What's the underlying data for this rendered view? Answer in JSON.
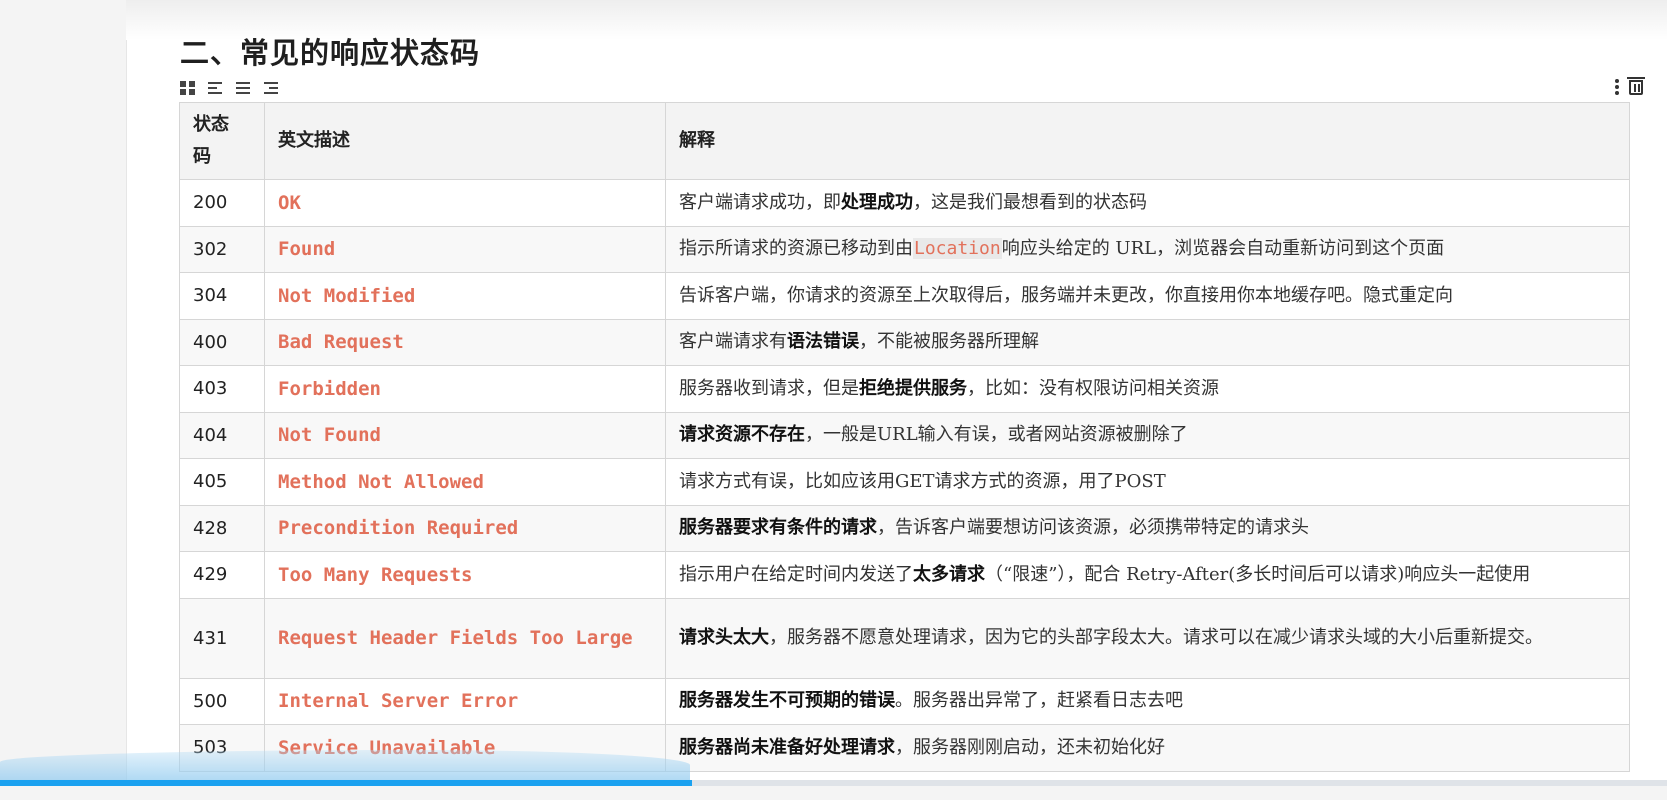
{
  "heading": "二、常见的响应状态码",
  "table": {
    "headers": [
      "状态\n码",
      "英文描述",
      "解释"
    ],
    "rows": [
      {
        "code": "200",
        "desc": "OK",
        "expl": [
          {
            "t": "客户端请求成功，即"
          },
          {
            "t": "处理成功",
            "b": true
          },
          {
            "t": "，这是我们最想看到的状态码"
          }
        ]
      },
      {
        "code": "302",
        "desc": "Found",
        "expl": [
          {
            "t": "指示所请求的资源已移动到由"
          },
          {
            "t": "Location",
            "c": true
          },
          {
            "t": "响应头给定的 URL，浏览器会自动重新访问到这个页面"
          }
        ]
      },
      {
        "code": "304",
        "desc": "Not Modified",
        "expl": [
          {
            "t": "告诉客户端，你请求的资源至上次取得后，服务端并未更改，你直接用你本地缓存吧。隐式重定向"
          }
        ]
      },
      {
        "code": "400",
        "desc": "Bad Request",
        "expl": [
          {
            "t": "客户端请求有"
          },
          {
            "t": "语法错误",
            "b": true
          },
          {
            "t": "，不能被服务器所理解"
          }
        ]
      },
      {
        "code": "403",
        "desc": "Forbidden",
        "expl": [
          {
            "t": "服务器收到请求，但是"
          },
          {
            "t": "拒绝提供服务",
            "b": true
          },
          {
            "t": "，比如：没有权限访问相关资源"
          }
        ]
      },
      {
        "code": "404",
        "desc": "Not Found",
        "expl": [
          {
            "t": "请求资源不存在",
            "b": true
          },
          {
            "t": "，一般是URL输入有误，或者网站资源被删除了"
          }
        ]
      },
      {
        "code": "405",
        "desc": "Method Not Allowed",
        "expl": [
          {
            "t": "请求方式有误，比如应该用GET请求方式的资源，用了POST"
          }
        ]
      },
      {
        "code": "428",
        "desc": "Precondition Required",
        "expl": [
          {
            "t": "服务器要求有条件的请求",
            "b": true
          },
          {
            "t": "，告诉客户端要想访问该资源，必须携带特定的请求头"
          }
        ]
      },
      {
        "code": "429",
        "desc": "Too Many Requests",
        "expl": [
          {
            "t": "指示用户在给定时间内发送了"
          },
          {
            "t": "太多请求",
            "b": true
          },
          {
            "t": "（“限速”），配合 Retry-After(多长时间后可以请求)响应头一起使用"
          }
        ]
      },
      {
        "code": "431",
        "desc": "Request Header Fields Too Large",
        "tall": true,
        "expl": [
          {
            "t": "请求头太大",
            "b": true
          },
          {
            "t": "，服务器不愿意处理请求，因为它的头部字段太大。请求可以在减少请求头域的大小后重新提交。"
          }
        ]
      },
      {
        "code": "500",
        "desc": "Internal Server Error",
        "expl": [
          {
            "t": "服务器发生不可预期的错误",
            "b": true
          },
          {
            "t": "。服务器出异常了，赶紧看日志去吧"
          }
        ]
      },
      {
        "code": "503",
        "desc": "Service Unavailable",
        "expl": [
          {
            "t": "服务器尚未准备好处理请求",
            "b": true
          },
          {
            "t": "，服务器刚刚启动，还未初始化好"
          }
        ]
      }
    ]
  },
  "video_progress": 0.415,
  "colors": {
    "accent": "#e2715b",
    "progress": "#1aa1f0"
  },
  "icons": [
    "grid-icon",
    "align-left-icon",
    "align-center-icon",
    "align-right-icon",
    "more-vertical-icon",
    "trash-icon"
  ]
}
